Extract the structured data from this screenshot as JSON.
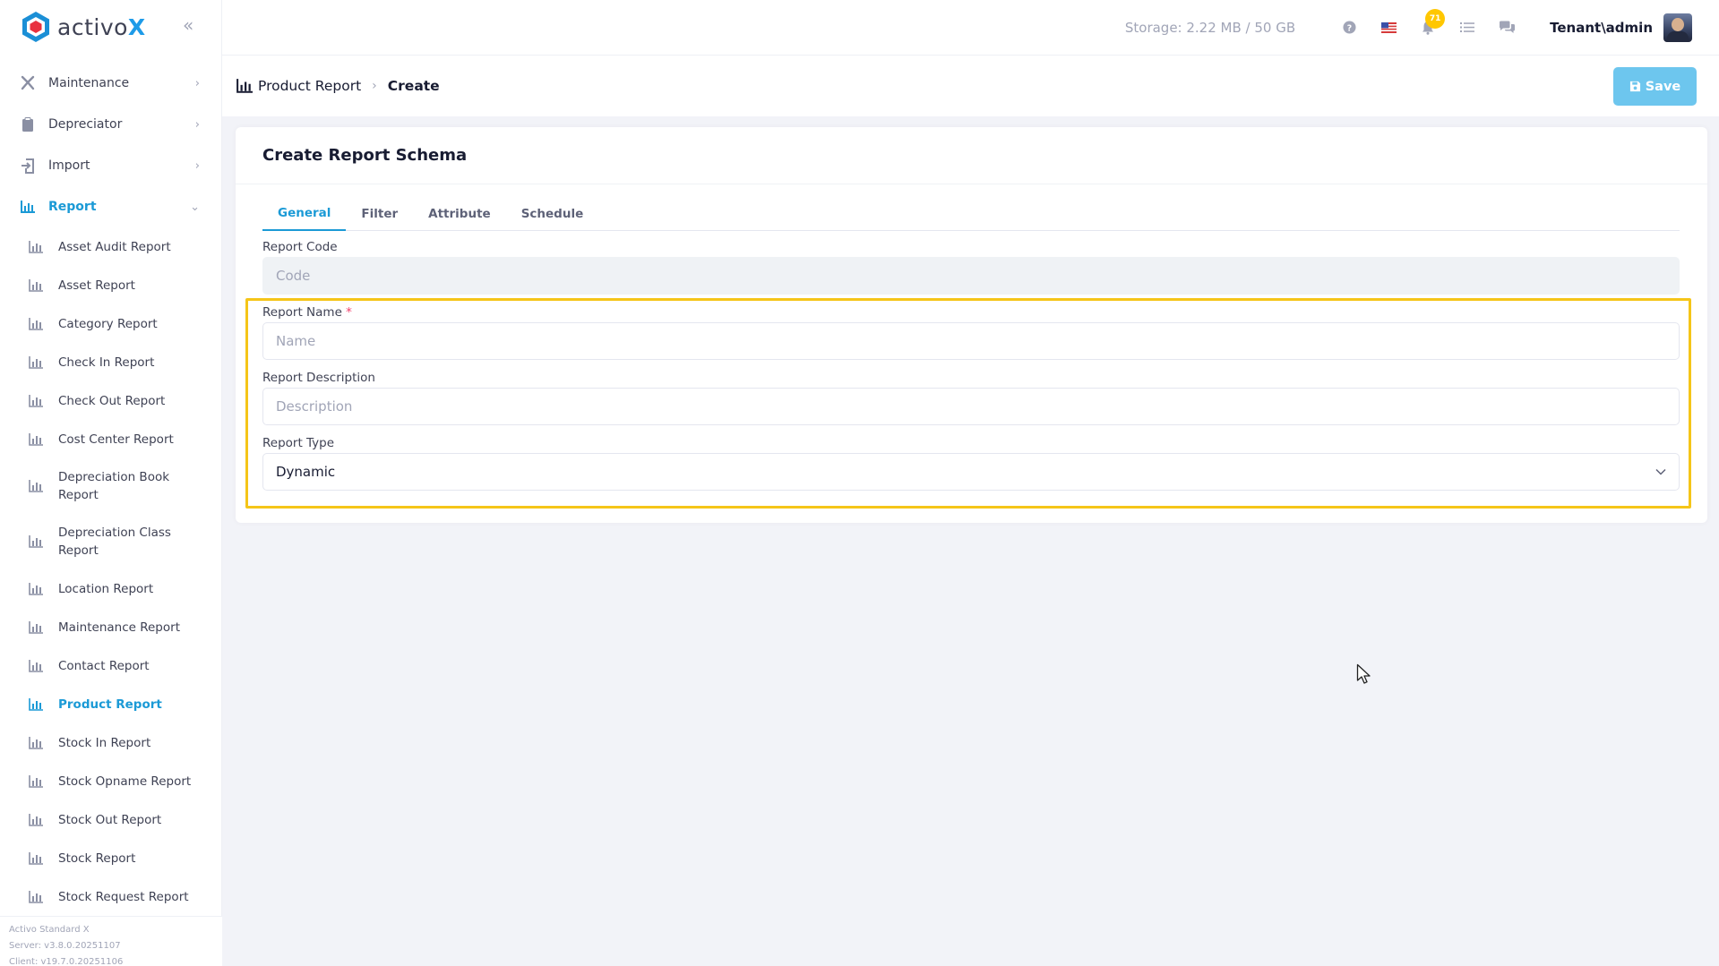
{
  "brand": {
    "name_prefix": "activo",
    "name_suffix": "X"
  },
  "sidebar": {
    "menu": [
      {
        "label": "Maintenance",
        "icon": "tools-icon",
        "arrow": "›"
      },
      {
        "label": "Depreciator",
        "icon": "clipboard-icon",
        "arrow": "›"
      },
      {
        "label": "Import",
        "icon": "import-icon",
        "arrow": "›"
      },
      {
        "label": "Report",
        "icon": "chart-icon",
        "arrow": "⌄",
        "active": true
      }
    ],
    "report_items": [
      {
        "label": "Asset Audit Report"
      },
      {
        "label": "Asset Report"
      },
      {
        "label": "Category Report"
      },
      {
        "label": "Check In Report"
      },
      {
        "label": "Check Out Report"
      },
      {
        "label": "Cost Center Report"
      },
      {
        "label": "Depreciation Book Report"
      },
      {
        "label": "Depreciation Class Report"
      },
      {
        "label": "Location Report"
      },
      {
        "label": "Maintenance Report"
      },
      {
        "label": "Contact Report"
      },
      {
        "label": "Product Report",
        "active": true
      },
      {
        "label": "Stock In Report"
      },
      {
        "label": "Stock Opname Report"
      },
      {
        "label": "Stock Out Report"
      },
      {
        "label": "Stock Report"
      },
      {
        "label": "Stock Request Report"
      }
    ],
    "version": {
      "edition": "Activo Standard X",
      "server": "Server: v3.8.0.20251107",
      "client": "Client: v19.7.0.20251106"
    }
  },
  "topbar": {
    "storage": "Storage: 2.22 MB / 50 GB",
    "notification_count": "71",
    "user": "Tenant\\admin"
  },
  "breadcrumb": {
    "parent": "Product Report",
    "separator": "›",
    "current": "Create"
  },
  "toolbar": {
    "save_label": "Save"
  },
  "card": {
    "title": "Create Report Schema",
    "tabs": [
      "General",
      "Filter",
      "Attribute",
      "Schedule"
    ],
    "active_tab": "General"
  },
  "form": {
    "report_code": {
      "label": "Report Code",
      "placeholder": "Code"
    },
    "report_name": {
      "label": "Report Name",
      "required_mark": "*",
      "placeholder": "Name"
    },
    "report_description": {
      "label": "Report Description",
      "placeholder": "Description"
    },
    "report_type": {
      "label": "Report Type",
      "value": "Dynamic"
    }
  },
  "colors": {
    "accent": "#1b9ad6",
    "save_button": "#6dc6ee",
    "highlight": "#f5c518",
    "badge": "#ffc700"
  }
}
